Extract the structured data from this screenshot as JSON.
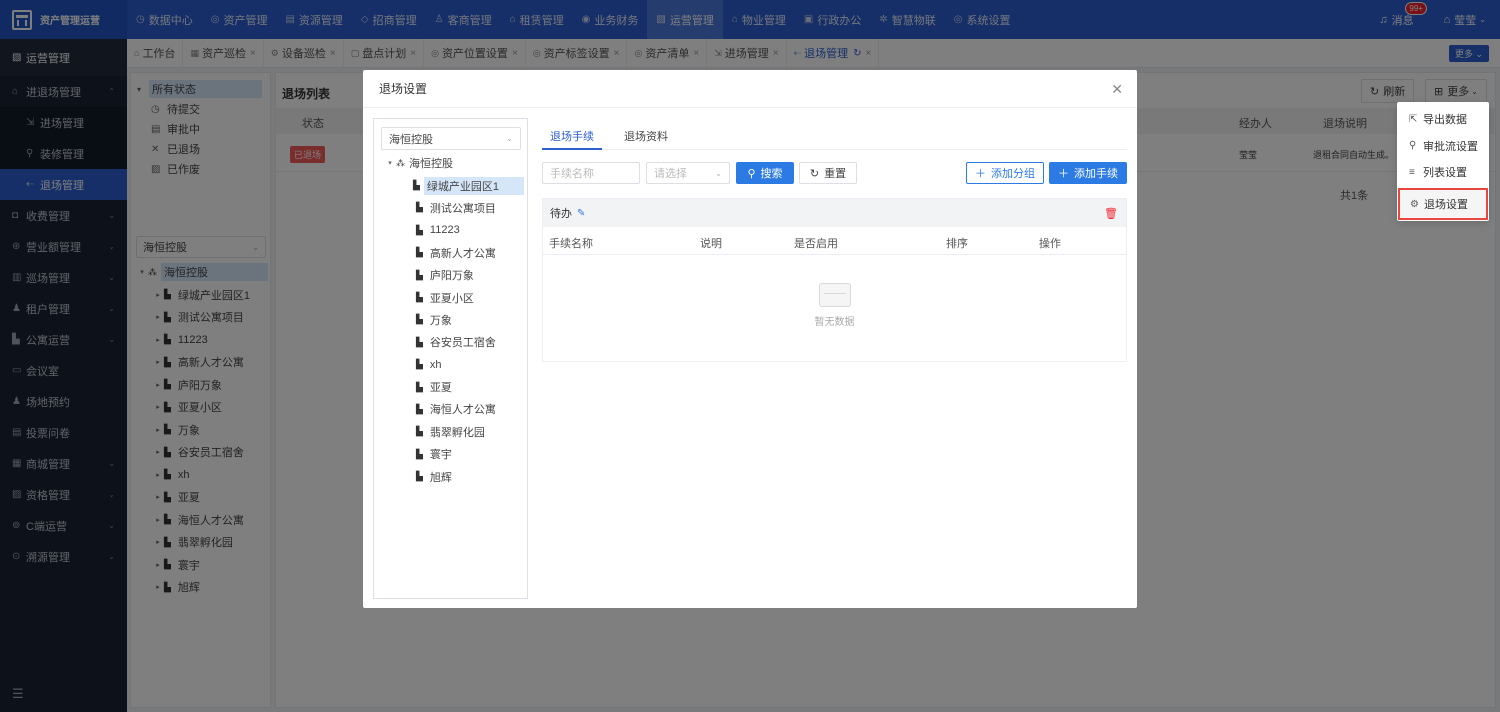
{
  "app": {
    "title": "资产管理运营"
  },
  "topnav": [
    {
      "icon": "◷",
      "label": "数据中心"
    },
    {
      "icon": "◎",
      "label": "资产管理"
    },
    {
      "icon": "▤",
      "label": "资源管理"
    },
    {
      "icon": "◇",
      "label": "招商管理"
    },
    {
      "icon": "♙",
      "label": "客商管理"
    },
    {
      "icon": "⌂",
      "label": "租赁管理"
    },
    {
      "icon": "◉",
      "label": "业务财务"
    },
    {
      "icon": "▧",
      "label": "运营管理",
      "active": true
    },
    {
      "icon": "⌂",
      "label": "物业管理"
    },
    {
      "icon": "▣",
      "label": "行政办公"
    },
    {
      "icon": "✲",
      "label": "智慧物联"
    },
    {
      "icon": "◎",
      "label": "系统设置"
    }
  ],
  "header": {
    "messages": "消息",
    "badge": "99+",
    "user": "莹莹"
  },
  "sidebar": {
    "head": "运营管理",
    "items": [
      {
        "icon": "⌂",
        "label": "进退场管理",
        "arrow": "⌃"
      },
      {
        "icon": "⇲",
        "label": "进场管理",
        "sub": true
      },
      {
        "icon": "⚲",
        "label": "装修管理",
        "sub": true
      },
      {
        "icon": "⇠",
        "label": "退场管理",
        "sub": true,
        "active": true
      },
      {
        "icon": "◘",
        "label": "收费管理",
        "arrow": "⌄"
      },
      {
        "icon": "⊛",
        "label": "营业额管理",
        "arrow": "⌄"
      },
      {
        "icon": "▥",
        "label": "巡场管理",
        "arrow": "⌄"
      },
      {
        "icon": "♟",
        "label": "租户管理",
        "arrow": "⌄"
      },
      {
        "icon": "▙",
        "label": "公寓运营",
        "arrow": "⌄"
      },
      {
        "icon": "▭",
        "label": "会议室",
        "arrow": ""
      },
      {
        "icon": "♟",
        "label": "场地预约",
        "arrow": ""
      },
      {
        "icon": "▤",
        "label": "投票问卷",
        "arrow": ""
      },
      {
        "icon": "▦",
        "label": "商城管理",
        "arrow": "⌄"
      },
      {
        "icon": "▨",
        "label": "资格管理",
        "arrow": "⌄"
      },
      {
        "icon": "⊚",
        "label": "C端运营",
        "arrow": "⌄"
      },
      {
        "icon": "⊙",
        "label": "溯源管理",
        "arrow": "⌄"
      }
    ],
    "collapse_icon": "☰"
  },
  "tabs": [
    {
      "icon": "⌂",
      "label": "工作台",
      "close": false
    },
    {
      "icon": "▦",
      "label": "资产巡检",
      "close": true
    },
    {
      "icon": "⚙",
      "label": "设备巡检",
      "close": true
    },
    {
      "icon": "▢",
      "label": "盘点计划",
      "close": true
    },
    {
      "icon": "◎",
      "label": "资产位置设置",
      "close": true
    },
    {
      "icon": "◎",
      "label": "资产标签设置",
      "close": true
    },
    {
      "icon": "◎",
      "label": "资产清单",
      "close": true
    },
    {
      "icon": "⇲",
      "label": "进场管理",
      "close": true
    },
    {
      "icon": "⇠",
      "label": "退场管理",
      "close": true,
      "active": true
    }
  ],
  "tabs_more": "更多 ⌄",
  "status_tree": {
    "all": "所有状态",
    "items": [
      {
        "icon": "◷",
        "label": "待提交"
      },
      {
        "icon": "▤",
        "label": "审批中"
      },
      {
        "icon": "✕",
        "label": "已退场"
      },
      {
        "icon": "▨",
        "label": "已作废"
      }
    ]
  },
  "org_select": "海恒控股",
  "org_tree": {
    "root": "海恒控股",
    "children": [
      "绿城产业园区1",
      "测试公寓项目",
      "11223",
      "高新人才公寓",
      "庐阳万象",
      "亚夏小区",
      "万象",
      "谷安员工宿舍",
      "xh",
      "亚夏",
      "海恒人才公寓",
      "翡翠孵化园",
      "寰宇",
      "旭辉"
    ]
  },
  "list": {
    "title": "退场列表",
    "columns": {
      "status": "状态",
      "handler": "经办人",
      "note": "退场说明"
    },
    "row": {
      "status": "已退场",
      "handler": "莹莹",
      "note": "退租合同自动生成。"
    },
    "pager": "共1条",
    "refresh": "刷新",
    "more": "更多"
  },
  "modal": {
    "title": "退场设置",
    "tree_select": "海恒控股",
    "tabs": [
      "退场手续",
      "退场资料"
    ],
    "search_placeholder": "手续名称",
    "select_placeholder": "请选择",
    "btn_search": "搜索",
    "btn_reset": "重置",
    "btn_add_group": "添加分组",
    "btn_add_procedure": "添加手续",
    "group_name": "待办",
    "columns": [
      "手续名称",
      "说明",
      "是否启用",
      "排序",
      "操作"
    ],
    "empty": "暂无数据"
  },
  "dropdown": [
    {
      "icon": "⇱",
      "label": "导出数据"
    },
    {
      "icon": "⚲",
      "label": "审批流设置"
    },
    {
      "icon": "≡",
      "label": "列表设置"
    },
    {
      "icon": "⚙",
      "label": "退场设置"
    }
  ]
}
